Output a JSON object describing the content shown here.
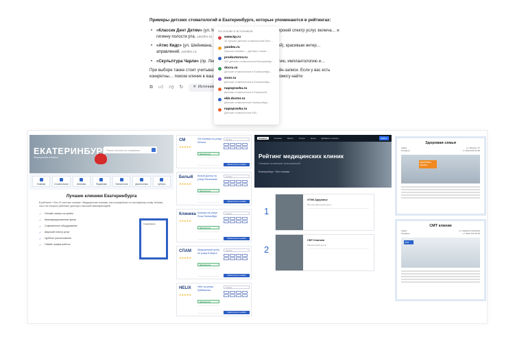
{
  "answer": {
    "heading": "Примеры детских стоматологий в Екатеринбурге, которые упоминаются в рейтингах:",
    "items": [
      {
        "name": "«Классик Дент Детям»",
        "text": " (ул. Ма… 25 дней в году, предлагает широкий спектр услуг, включа… и гигиену полости рта.",
        "source": "yandex.ru"
      },
      {
        "name": "«Атис Кидс»",
        "text": " (ул. Шейнмана, 1… зонами (лабиринты, аэрохоккей), красивым интер… аправлений.",
        "source": "yandex.ru"
      },
      {
        "name": "«Скульптура Чарли»",
        "text": " (пр. Лени… тром услуг, включая ортодонтию, имплантологию и…",
        "source": ""
      }
    ],
    "closing": "При выборе также стоит учитыват… ик работы и возможность онлайн-записи. Если у вас есть конкретны… поиске клиник в вашем районе, уточните детали — я помогу найти",
    "sources_label": "Источники"
  },
  "popup": {
    "heading": "На основе 9 источников:",
    "sources": [
      {
        "domain": "www.kp.ru",
        "desc": "10 лучших детских стоматологий Екат…",
        "color": "#d93a3a"
      },
      {
        "domain": "yandex.ru",
        "desc": "Лучшие клиники — детские стомат…",
        "color": "#f2a11e"
      },
      {
        "domain": "prodoctorov.ru",
        "desc": "100 детских стоматологов Екатеринбур…",
        "color": "#2d64c8"
      },
      {
        "domain": "docru.ru",
        "desc": "Детские стоматологии в Екатеринбур…",
        "color": "#2d9c5a"
      },
      {
        "domain": "zoon.ru",
        "desc": "Детские стоматологии в Екатеринбур…",
        "color": "#7a4bd1"
      },
      {
        "domain": "napopravku.ru",
        "desc": "Детская стоматология в Екатеринб…",
        "color": "#e85d2a"
      },
      {
        "domain": "ekb.doctor.ru",
        "desc": "Детские стоматологии Екатеринбур…",
        "color": "#2d64c8"
      },
      {
        "domain": "napopravku.ru",
        "desc": "Детские стоматологии Екб…",
        "color": "#e85d2a"
      }
    ]
  },
  "panel1": {
    "hero_title": "ЕКАТЕРИНБУРГ",
    "hero_sub": "Медицинские клиники",
    "search_placeholder": "Поиск клиник по названию",
    "categories": [
      "Клиники",
      "Стоматологии",
      "Анализы",
      "Педиатрия",
      "Гинекология",
      "Диагностика",
      "Центры"
    ],
    "title": "Лучшие клиники Екатеринбурга",
    "intro": "В рейтинге «Топ-10 частных клиник». Медицинские клиники, как оснащённые по последнему слову техники, так и на которых работают доктора с высокой квалификацией.",
    "checks": [
      "Онлайн-запись на приём",
      "Квалифицированные врачи",
      "Современное оборудование",
      "Широкий спектр услуг",
      "Удобное расположение",
      "Гибкий график работы"
    ],
    "toc_label": "Содержание"
  },
  "panel2": {
    "clinics": [
      {
        "logo": "СМ",
        "name": "СМ-Клиника на улице Ленина",
        "stars": "★★★★★"
      },
      {
        "logo": "Белый",
        "name": "Белый Доктор на улице Малышева",
        "stars": "★★★★★"
      },
      {
        "logo": "Клиника",
        "name": "Клиника на улице Розы Люксембург",
        "stars": "★★★★★"
      },
      {
        "logo": "СПАМ",
        "name": "Медицинский центр на улице 8 Марта",
        "stars": "★★★★★"
      },
      {
        "logo": "HELIX",
        "name": "Helix на улице Куйбышева",
        "stars": "★★★★★"
      }
    ],
    "select_label": "Услуги",
    "call_label": "Записаться",
    "book_label": "Записаться онлайн"
  },
  "panel3": {
    "nav": [
      "Клиники",
      "Врачи",
      "Услуги",
      "Цены",
      "Добавить клинику"
    ],
    "brand": "Клиники",
    "cta": "Войти",
    "title": "Рейтинг медицинских клиник",
    "subtitle": "Основано на мнениях пользователей",
    "meta": "Екатеринбург · Все клиники",
    "rows": [
      {
        "rank": "1",
        "name": "УГМК-Здоровье",
        "desc": "Многопрофильный центр"
      },
      {
        "rank": "2",
        "name": "СМТ Клиника",
        "desc": "Медицинский центр"
      }
    ]
  },
  "panel4": {
    "cards": [
      {
        "title": "Здоровая семья",
        "addr_label": "Адрес",
        "addr": "ул. Фрунзе, 67",
        "phone_label": "Телефон",
        "phone": "+7 (343) 219-51-95",
        "sign": "ЗДОРОВАЯ СЕМЬЯ"
      },
      {
        "title": "СМТ клиник",
        "addr_label": "Адрес",
        "addr": "ул. Мамина-Сибиряка",
        "phone_label": "Телефон",
        "phone": "+7 (343) 311-33-33",
        "sign": "СМТ"
      }
    ]
  }
}
